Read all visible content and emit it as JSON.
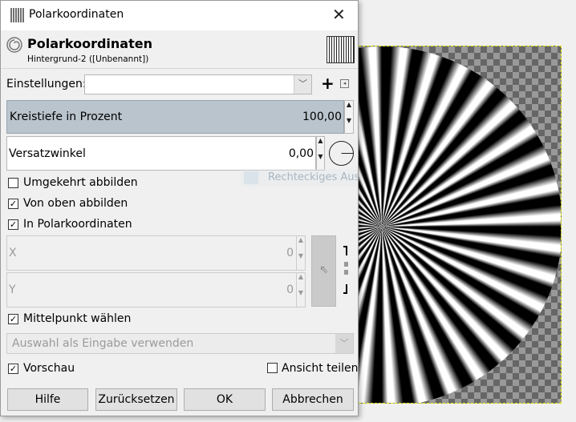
{
  "window": {
    "title": "Polarkoordinaten",
    "close_icon": "close-icon"
  },
  "header": {
    "title": "Polarkoordinaten",
    "subtitle": "Hintergrund-2 ([Unbenannt])"
  },
  "settings": {
    "label": "Einstellungen:",
    "value": "",
    "add_icon": "plus-icon",
    "menu_icon": "menu-left-icon"
  },
  "circle_depth": {
    "label": "Kreistiefe in Prozent",
    "value": "100,00",
    "fill_percent": 100
  },
  "offset_angle": {
    "label": "Versatzwinkel",
    "value": "0,00"
  },
  "checkboxes": {
    "inverse": {
      "label": "Umgekehrt abbilden",
      "checked": false
    },
    "from_top": {
      "label": "Von oben abbilden",
      "checked": true
    },
    "polar": {
      "label": "In Polarkoordinaten",
      "checked": true
    },
    "center": {
      "label": "Mittelpunkt wählen",
      "checked": true
    }
  },
  "x_field": {
    "label": "X",
    "value": "0"
  },
  "y_field": {
    "label": "Y",
    "value": "0"
  },
  "selection_combo": {
    "value": "Auswahl als Eingabe verwenden"
  },
  "preview": {
    "label": "Vorschau",
    "checked": true
  },
  "split_view": {
    "label": "Ansicht teilen",
    "checked": false
  },
  "buttons": {
    "help": "Hilfe",
    "reset": "Zurücksetzen",
    "ok": "OK",
    "cancel": "Abbrechen"
  },
  "background": {
    "tooltip": "Rechteckiges Aus"
  },
  "colors": {
    "slider_fill": "#b9c4cd",
    "canvas_border": "#e8e800"
  }
}
